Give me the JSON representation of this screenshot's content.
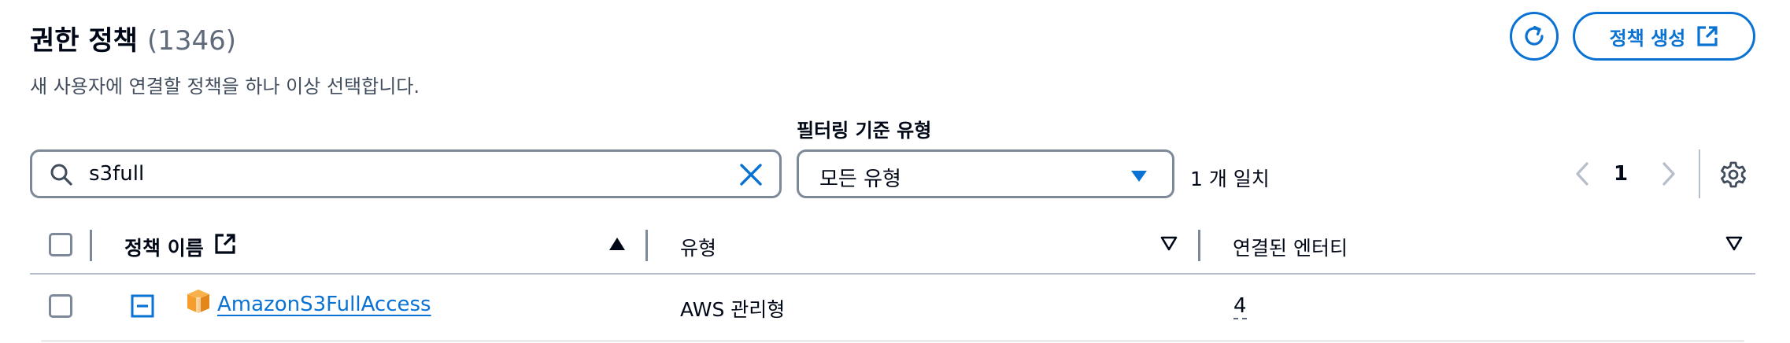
{
  "header": {
    "title": "권한 정책",
    "count": "(1346)",
    "subtitle": "새 사용자에 연결할 정책을 하나 이상 선택합니다.",
    "create_button_label": "정책 생성"
  },
  "filter": {
    "search_value": "s3full",
    "type_label": "필터링 기준 유형",
    "type_selected": "모든 유형",
    "match_text": "1 개 일치"
  },
  "pagination": {
    "current_page": "1"
  },
  "table": {
    "columns": [
      {
        "label": "정책 이름"
      },
      {
        "label": "유형"
      },
      {
        "label": "연결된 엔터티"
      }
    ],
    "rows": [
      {
        "name": "AmazonS3FullAccess",
        "type": "AWS 관리형",
        "entities": "4"
      }
    ]
  },
  "colors": {
    "accent": "#0972d3",
    "text": "#000716",
    "border": "#7d8998",
    "aws_icon": "#f59e2c"
  },
  "icons": [
    "refresh-icon",
    "external-link-icon",
    "search-icon",
    "clear-icon",
    "caret-down-icon",
    "chevron-left-icon",
    "chevron-right-icon",
    "settings-icon",
    "sort-ascending-icon",
    "sort-descending-icon",
    "expand-icon",
    "aws-policy-icon"
  ]
}
